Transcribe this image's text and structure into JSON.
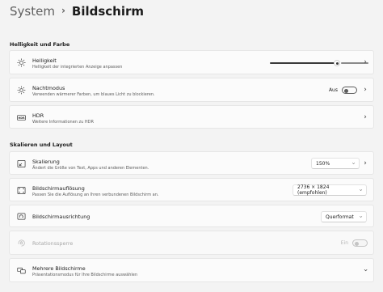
{
  "breadcrumb": {
    "parent": "System",
    "separator": "›",
    "current": "Bildschirm"
  },
  "sections": {
    "brightness_color": "Helligkeit und Farbe",
    "scale_layout": "Skalieren und Layout"
  },
  "brightness": {
    "title": "Helligkeit",
    "description": "Helligkeit der integrierten Anzeige anpassen",
    "level": 0.68
  },
  "night_mode": {
    "title": "Nachtmodus",
    "description": "Verwenden wärmerer Farben, um blaues Licht zu blockieren.",
    "state_label": "Aus",
    "on": false
  },
  "hdr": {
    "badge": "HDR",
    "title": "HDR",
    "description": "Weitere Informationen zu HDR"
  },
  "scaling": {
    "title": "Skalierung",
    "description": "Ändert die Größe von Text, Apps und anderen Elementen.",
    "value": "150%"
  },
  "resolution": {
    "title": "Bildschirmauflösung",
    "description": "Passen Sie die Auflösung an Ihren verbundenen Bildschirm an.",
    "value": "2736 × 1824 (empfohlen)"
  },
  "orientation": {
    "title": "Bildschirmausrichtung",
    "value": "Querformat"
  },
  "rotation_lock": {
    "title": "Rotationssperre",
    "state_label": "Ein",
    "on": true,
    "disabled": true
  },
  "multiple_displays": {
    "title": "Mehrere Bildschirme",
    "description": "Präsentationsmodus für Ihre Bildschirme auswählen"
  },
  "icons": {
    "brightness": "sun-icon",
    "night_mode": "night-light-icon",
    "hdr": "hdr-icon",
    "scaling": "scale-icon",
    "resolution": "resolution-icon",
    "orientation": "orientation-icon",
    "rotation_lock": "rotation-lock-icon",
    "multiple_displays": "multiple-displays-icon"
  },
  "colors": {
    "accent": "#3a3a3a",
    "background": "#f3f3f3",
    "card": "#fbfbfb"
  }
}
